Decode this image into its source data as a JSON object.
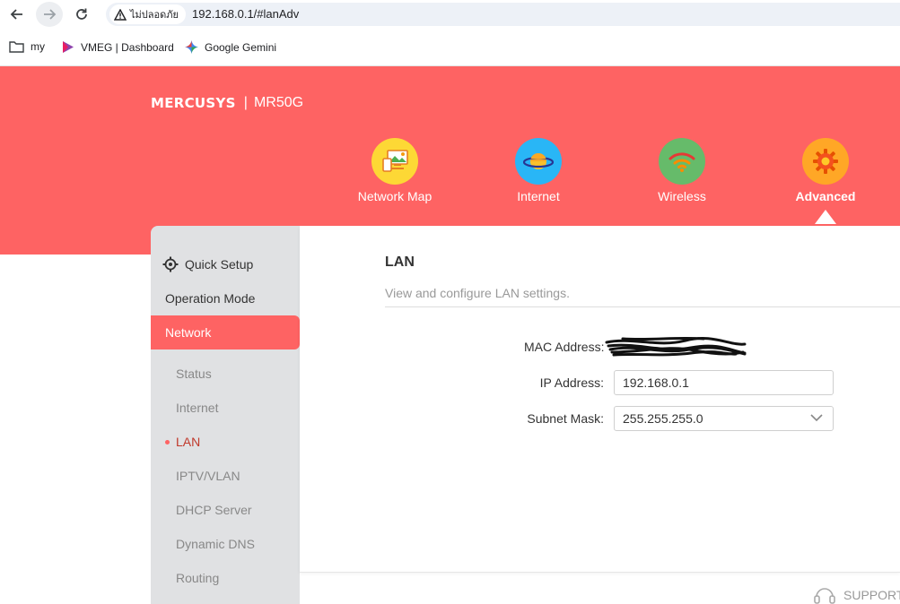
{
  "browser": {
    "security_label": "ไม่ปลอดภัย",
    "url": "192.168.0.1/#lanAdv",
    "bookmarks": [
      {
        "label": "my",
        "icon": "folder-icon"
      },
      {
        "label": "VMEG | Dashboard",
        "icon": "vmeg-logo-icon"
      },
      {
        "label": "Google Gemini",
        "icon": "gemini-icon"
      }
    ]
  },
  "header": {
    "brand": "MERCUSYS",
    "separator": "|",
    "model": "MR50G",
    "bg_color": "#fe6363",
    "nav": [
      {
        "label": "Network Map",
        "icon": "network-map-icon",
        "circle_color": "#fdd835",
        "active": false
      },
      {
        "label": "Internet",
        "icon": "internet-planet-icon",
        "circle_color": "#29b6f6",
        "active": false
      },
      {
        "label": "Wireless",
        "icon": "wireless-icon",
        "circle_color": "#66bb6a",
        "active": false
      },
      {
        "label": "Advanced",
        "icon": "advanced-gear-icon",
        "circle_color": "#ffa726",
        "active": true
      }
    ]
  },
  "sidebar": {
    "quick_setup": "Quick Setup",
    "operation_mode": "Operation Mode",
    "network": "Network",
    "sub_items": [
      {
        "label": "Status",
        "active": false
      },
      {
        "label": "Internet",
        "active": false
      },
      {
        "label": "LAN",
        "active": true
      },
      {
        "label": "IPTV/VLAN",
        "active": false
      },
      {
        "label": "DHCP Server",
        "active": false
      },
      {
        "label": "Dynamic DNS",
        "active": false
      },
      {
        "label": "Routing",
        "active": false
      }
    ]
  },
  "main": {
    "title": "LAN",
    "description": "View and configure LAN settings.",
    "mac_label": "MAC Address:",
    "mac_value": "[redacted]",
    "ip_label": "IP Address:",
    "ip_value": "192.168.0.1",
    "mask_label": "Subnet Mask:",
    "mask_value": "255.255.255.0"
  },
  "footer": {
    "support": "SUPPORT"
  }
}
